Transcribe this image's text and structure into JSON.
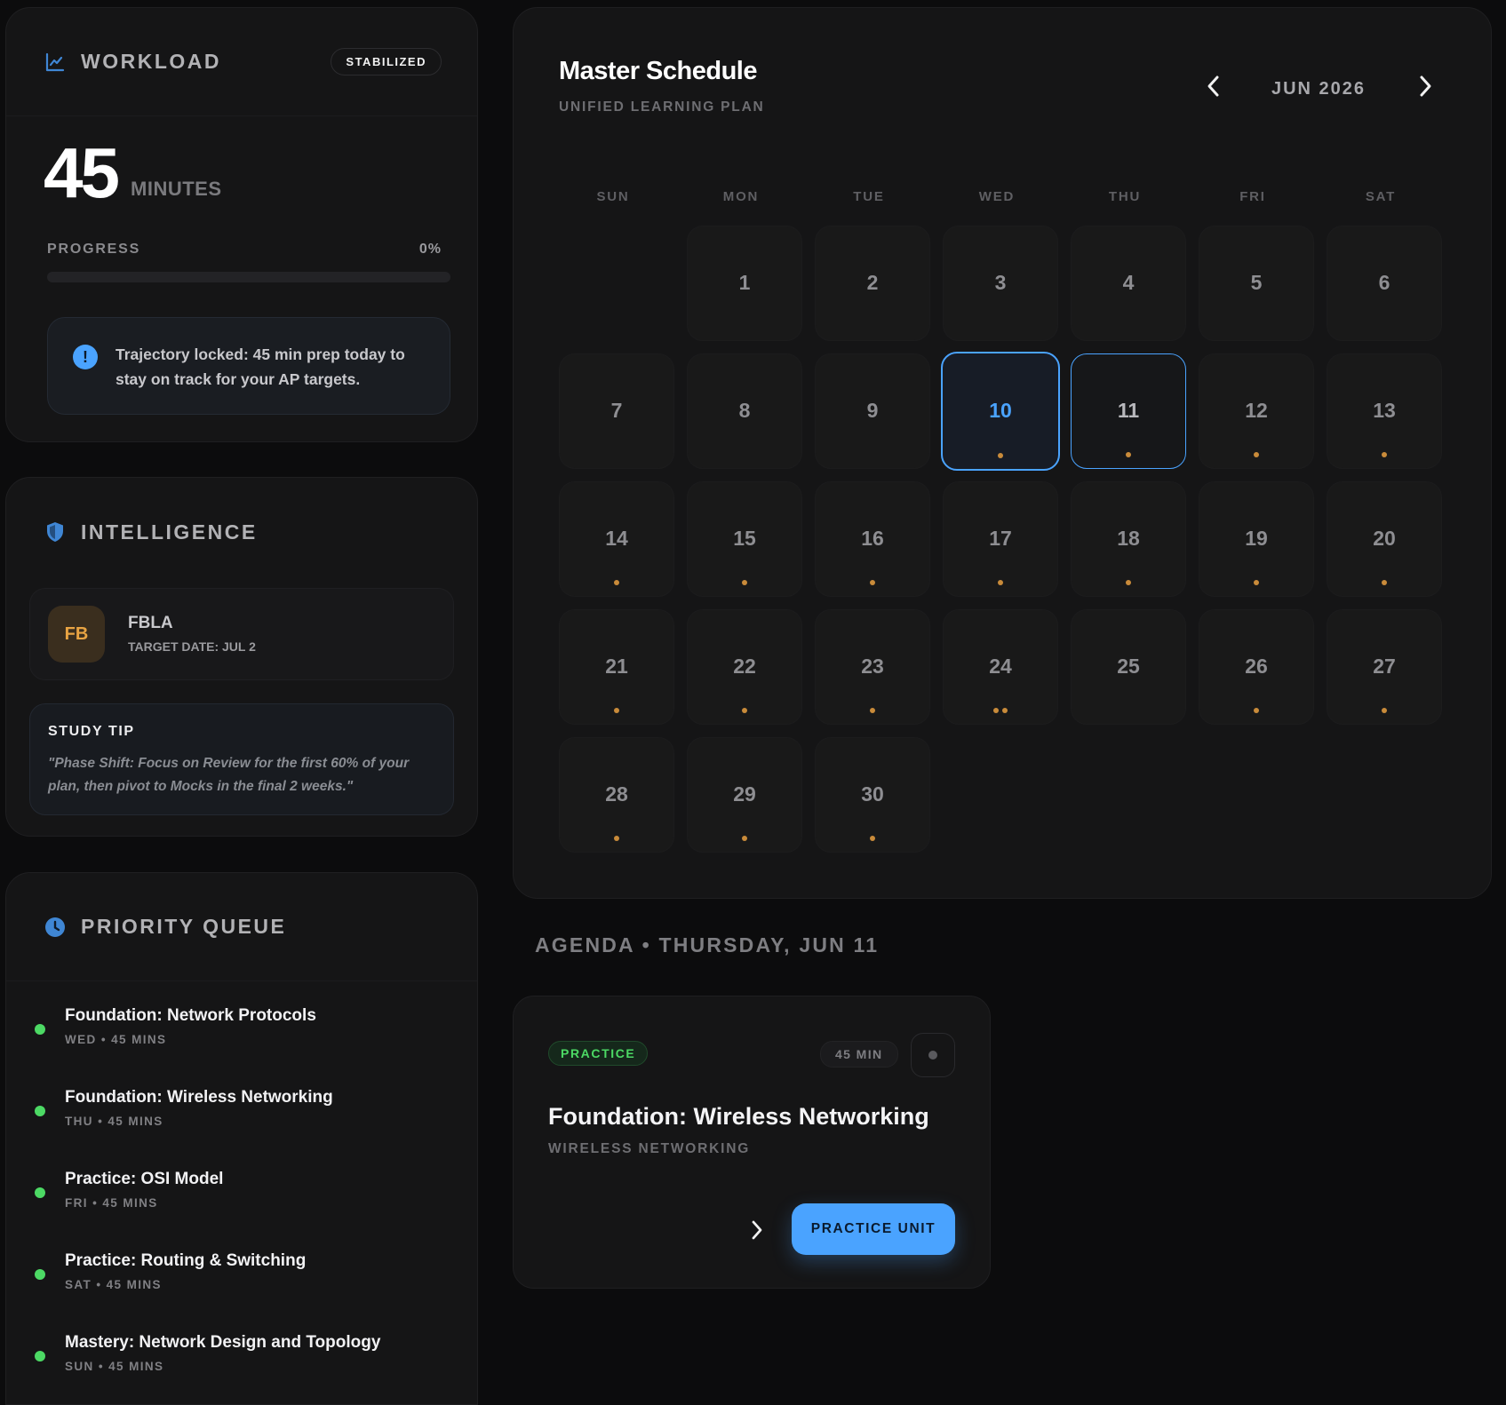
{
  "workload": {
    "title": "WORKLOAD",
    "status": "STABILIZED",
    "minutes": "45",
    "unit": "MINUTES",
    "progress_label": "PROGRESS",
    "progress_text": "0%",
    "progress_value": 0,
    "alert": "Trajectory locked: 45 min prep today to stay on track for your AP targets.",
    "icon": "trend-chart-icon"
  },
  "intelligence": {
    "title": "INTELLIGENCE",
    "icon": "shield-icon",
    "entity": {
      "initials": "FB",
      "name": "FBLA",
      "target": "TARGET DATE: JUL 2"
    },
    "tip_title": "STUDY TIP",
    "tip_text": "\"Phase Shift: Focus on Review for the first 60% of your plan, then pivot to Mocks in the final 2 weeks.\""
  },
  "queue": {
    "title": "PRIORITY QUEUE",
    "icon": "clock-icon",
    "items": [
      {
        "title": "Foundation: Network Protocols",
        "meta": "WED • 45 MINS"
      },
      {
        "title": "Foundation: Wireless Networking",
        "meta": "THU • 45 MINS"
      },
      {
        "title": "Practice: OSI Model",
        "meta": "FRI • 45 MINS"
      },
      {
        "title": "Practice: Routing & Switching",
        "meta": "SAT • 45 MINS"
      },
      {
        "title": "Mastery: Network Design and Topology",
        "meta": "SUN • 45 MINS"
      }
    ]
  },
  "calendar": {
    "title": "Master Schedule",
    "subtitle": "UNIFIED LEARNING PLAN",
    "month": "JUN 2026",
    "weekdays": [
      "SUN",
      "MON",
      "TUE",
      "WED",
      "THU",
      "FRI",
      "SAT"
    ],
    "first_weekday": 1,
    "days": [
      {
        "d": "1",
        "dots": 0
      },
      {
        "d": "2",
        "dots": 0
      },
      {
        "d": "3",
        "dots": 0
      },
      {
        "d": "4",
        "dots": 0
      },
      {
        "d": "5",
        "dots": 0
      },
      {
        "d": "6",
        "dots": 0
      },
      {
        "d": "7",
        "dots": 0
      },
      {
        "d": "8",
        "dots": 0
      },
      {
        "d": "9",
        "dots": 0
      },
      {
        "d": "10",
        "dots": 1,
        "state": "today"
      },
      {
        "d": "11",
        "dots": 1,
        "state": "selected"
      },
      {
        "d": "12",
        "dots": 1
      },
      {
        "d": "13",
        "dots": 1
      },
      {
        "d": "14",
        "dots": 1
      },
      {
        "d": "15",
        "dots": 1
      },
      {
        "d": "16",
        "dots": 1
      },
      {
        "d": "17",
        "dots": 1
      },
      {
        "d": "18",
        "dots": 1
      },
      {
        "d": "19",
        "dots": 1
      },
      {
        "d": "20",
        "dots": 1
      },
      {
        "d": "21",
        "dots": 1
      },
      {
        "d": "22",
        "dots": 1
      },
      {
        "d": "23",
        "dots": 1
      },
      {
        "d": "24",
        "dots": 2
      },
      {
        "d": "25",
        "dots": 0
      },
      {
        "d": "26",
        "dots": 1
      },
      {
        "d": "27",
        "dots": 1
      },
      {
        "d": "28",
        "dots": 1
      },
      {
        "d": "29",
        "dots": 1
      },
      {
        "d": "30",
        "dots": 1
      }
    ],
    "accent": "#4aa3ff",
    "dot_color": "#c98b3a"
  },
  "agenda": {
    "heading": "AGENDA • THURSDAY, JUN 11",
    "tag": "PRACTICE",
    "duration": "45 MIN",
    "title": "Foundation: Wireless Networking",
    "subtitle": "WIRELESS NETWORKING",
    "cta": "PRACTICE UNIT"
  }
}
